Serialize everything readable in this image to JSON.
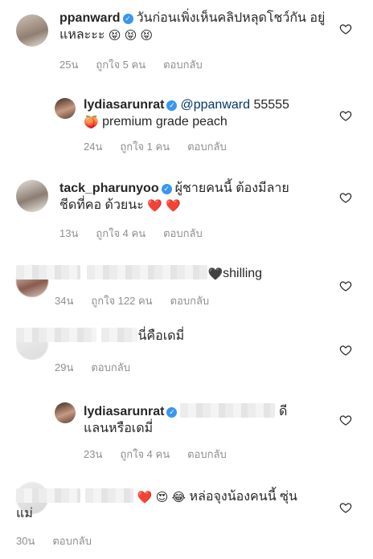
{
  "comments": [
    {
      "username": "ppanward",
      "text": "วันก่อนเพิ่งเห็นคลิปหลุดโชว์กัน อยู่แหละะะ",
      "emojis": "😝 😝 😝",
      "time": "25น",
      "likes": "ถูกใจ 5 คน",
      "reply": "ตอบกลับ"
    },
    {
      "username": "lydiasarunrat",
      "mention": "@ppanward",
      "text": "55555",
      "emoji": "🍑",
      "text2": "premium grade peach",
      "time": "24น",
      "likes": "ถูกใจ 1 คน",
      "reply": "ตอบกลับ"
    },
    {
      "username": "tack_pharunyoo",
      "text": "ผู้ชายคนนี้ ต้องมีลาย",
      "text2": "ชีดที่คอ ด้วยนะ",
      "emojis": "❤️ ❤️",
      "time": "13น",
      "likes": "ถูกใจ 4 คน",
      "reply": "ตอบกลับ"
    },
    {
      "emoji": "🖤",
      "text": "shilling",
      "time": "34น",
      "likes": "ถูกใจ 122 คน",
      "reply": "ตอบกลับ"
    },
    {
      "text": "นี่คือเดมี่",
      "time": "29น",
      "reply": "ตอบกลับ"
    },
    {
      "username": "lydiasarunrat",
      "text": "ดี",
      "text2": "แลนหรือเดมี่",
      "time": "23น",
      "likes": "ถูกใจ 4 คน",
      "reply": "ตอบกลับ"
    },
    {
      "emojis": "❤️ 😍 😂",
      "text": "หล่อจุงน้องคนนี้ ซุ่น",
      "text2": "แม่",
      "time": "30น",
      "reply": "ตอบกลับ"
    }
  ],
  "icons": {
    "like": "heart-outline-icon",
    "verified": "verified-badge-icon"
  },
  "colors": {
    "verified": "#3897f0",
    "muted": "#8e8e8e",
    "heart": "#e0245e"
  }
}
